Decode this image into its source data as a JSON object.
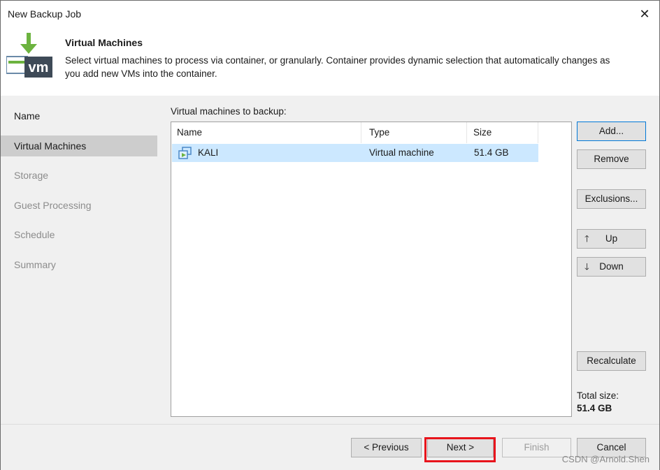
{
  "window": {
    "title": "New Backup Job"
  },
  "header": {
    "title": "Virtual Machines",
    "description": "Select virtual machines to process via container, or granularly. Container provides dynamic selection that automatically changes as you add new VMs into the container.",
    "icon": "vm-download-icon"
  },
  "nav": {
    "items": [
      {
        "label": "Name",
        "state": "normal"
      },
      {
        "label": "Virtual Machines",
        "state": "active"
      },
      {
        "label": "Storage",
        "state": "disabled"
      },
      {
        "label": "Guest Processing",
        "state": "disabled"
      },
      {
        "label": "Schedule",
        "state": "disabled"
      },
      {
        "label": "Summary",
        "state": "disabled"
      }
    ]
  },
  "content": {
    "list_label": "Virtual machines to backup:",
    "columns": [
      "Name",
      "Type",
      "Size"
    ],
    "rows": [
      {
        "name": "KALI",
        "type": "Virtual machine",
        "size": "51.4 GB",
        "icon": "vm-icon"
      }
    ],
    "buttons": {
      "add": "Add...",
      "remove": "Remove",
      "exclusions": "Exclusions...",
      "up": "Up",
      "down": "Down",
      "recalculate": "Recalculate"
    },
    "total_label": "Total size:",
    "total_value": "51.4 GB"
  },
  "footer": {
    "previous": "< Previous",
    "next": "Next >",
    "finish": "Finish",
    "cancel": "Cancel"
  },
  "watermark": "CSDN @Arnold.Shen",
  "colors": {
    "selection": "#cce8ff",
    "highlight": "#e8141c",
    "active_nav": "#cdcdcd",
    "icon_green": "#6cb33f"
  }
}
